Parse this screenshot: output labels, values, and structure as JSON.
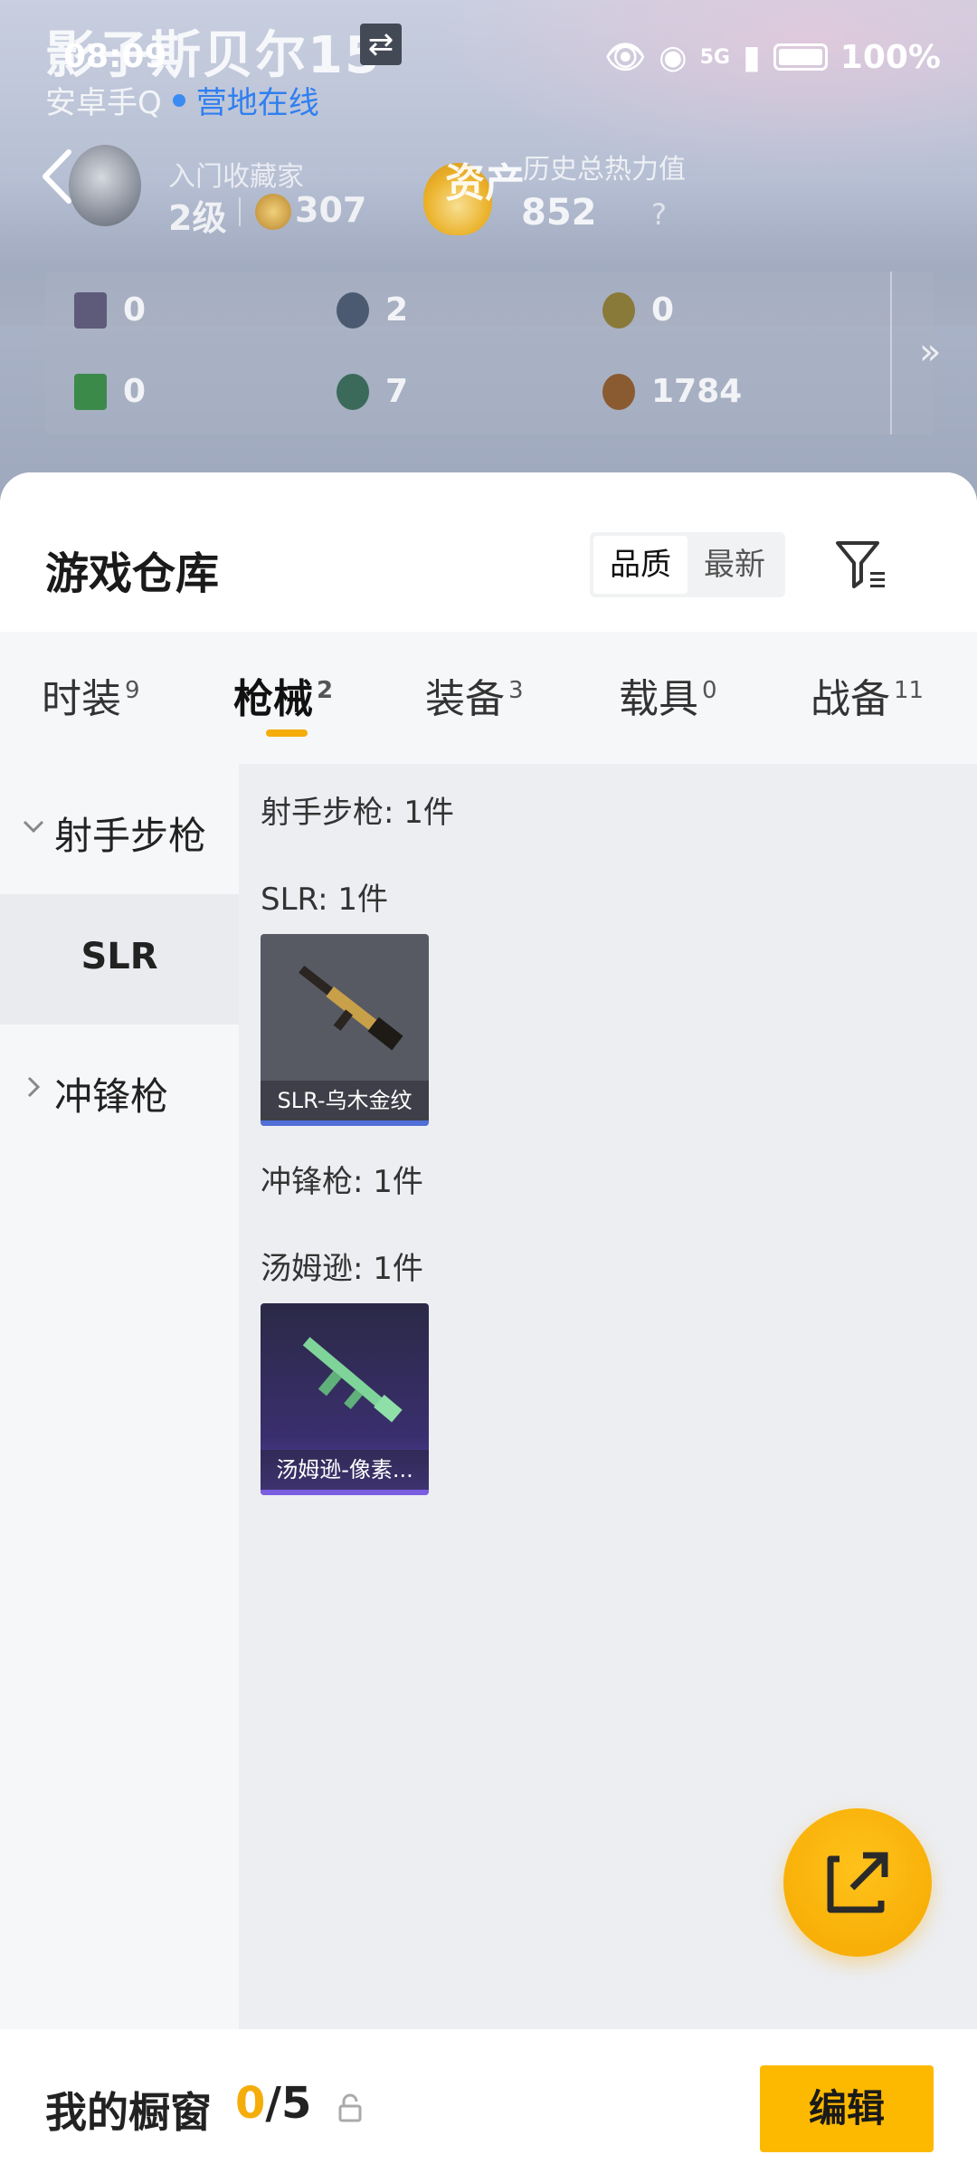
{
  "status_bar": {
    "time": "08:09",
    "signal_label": "5G",
    "battery": "100%"
  },
  "header": {
    "player_name": "影子斯贝尔15",
    "platform": "安卓手Q",
    "online_status": "营地在线",
    "rank_title": "入门收藏家",
    "rank_level": "2级",
    "rank_points": "307",
    "assets_label": "资产",
    "heat_label": "历史总热力值",
    "heat_value": "852",
    "help": "?",
    "stats": [
      {
        "icon": "card-icon",
        "value": "0",
        "color": "#5d5a7a"
      },
      {
        "icon": "coin-blue-icon",
        "value": "2",
        "color": "#4b5a70"
      },
      {
        "icon": "coin-gold-icon",
        "value": "0",
        "color": "#8a7a3a"
      },
      {
        "icon": "green-card-icon",
        "value": "0",
        "color": "#3b8a4a"
      },
      {
        "icon": "coin-green-icon",
        "value": "7",
        "color": "#3b6a5a"
      },
      {
        "icon": "coin-bronze-icon",
        "value": "1784",
        "color": "#8a5a30"
      }
    ]
  },
  "sheet": {
    "title": "游戏仓库",
    "sort_options": [
      "品质",
      "最新"
    ],
    "tabs": [
      {
        "label": "时装",
        "count": "9"
      },
      {
        "label": "枪械",
        "count": "2"
      },
      {
        "label": "装备",
        "count": "3"
      },
      {
        "label": "载具",
        "count": "0"
      },
      {
        "label": "战备",
        "count": "11"
      }
    ],
    "categories": [
      {
        "label": "射手步枪",
        "expanded": true
      },
      {
        "label": "SLR",
        "selected": true
      },
      {
        "label": "冲锋枪",
        "expanded": false
      }
    ],
    "groups": [
      {
        "category_label": "射手步枪: 1件",
        "sub_label": "SLR: 1件",
        "item_name": "SLR-乌木金纹",
        "bar_color": "#4f6fd6"
      },
      {
        "category_label": "冲锋枪: 1件",
        "sub_label": "汤姆逊: 1件",
        "item_name": "汤姆逊-像素...",
        "bar_color": "#7a5de0"
      }
    ]
  },
  "bottom": {
    "label": "我的橱窗",
    "current": "0",
    "total": "/5",
    "edit_label": "编辑"
  },
  "colors": {
    "accent": "#f5ad0b",
    "online": "#2f7ff0"
  }
}
